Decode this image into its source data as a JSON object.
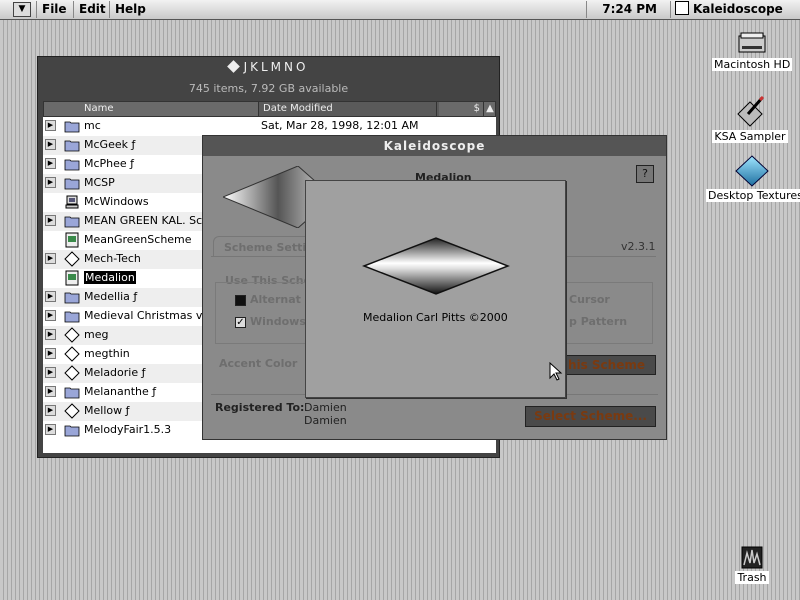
{
  "menubar": {
    "items": [
      "File",
      "Edit",
      "Help"
    ],
    "clock": "7:24 PM",
    "app_name": "Kaleidoscope"
  },
  "desktop": {
    "icons": [
      {
        "label": "Macintosh HD",
        "icon": "hard-disk-icon"
      },
      {
        "label": "KSA Sampler",
        "icon": "paintbrush-icon"
      },
      {
        "label": "Desktop Textures",
        "icon": "diamond-icon"
      },
      {
        "label": "Trash",
        "icon": "trash-icon"
      }
    ]
  },
  "finder": {
    "title": "JKLMNO",
    "info": "745 items, 7.92 GB available",
    "columns": {
      "name": "Name",
      "date": "Date Modified",
      "sort": "$"
    },
    "rows": [
      {
        "name": "mc",
        "date": "Sat, Mar 28, 1998, 12:01 AM",
        "icon": "folder-icon",
        "has_triangle": true
      },
      {
        "name": "McGeek ƒ",
        "date": "",
        "icon": "folder-icon",
        "has_triangle": true
      },
      {
        "name": "McPhee ƒ",
        "date": "",
        "icon": "folder-icon",
        "has_triangle": true
      },
      {
        "name": "MCSP",
        "date": "",
        "icon": "folder-icon",
        "has_triangle": true
      },
      {
        "name": "McWindows",
        "date": "",
        "icon": "computer-icon",
        "has_triangle": false
      },
      {
        "name": "MEAN GREEN KAL. Scher",
        "date": "",
        "icon": "folder-icon",
        "has_triangle": true
      },
      {
        "name": "MeanGreenScheme",
        "date": "",
        "icon": "scheme-file-icon",
        "has_triangle": false
      },
      {
        "name": "Mech-Tech",
        "date": "",
        "icon": "diamond-folder-icon",
        "has_triangle": true
      },
      {
        "name": "Medalion",
        "date": "",
        "icon": "scheme-file-icon",
        "has_triangle": false,
        "selected": true
      },
      {
        "name": "Medellia ƒ",
        "date": "",
        "icon": "folder-icon",
        "has_triangle": true
      },
      {
        "name": "Medieval Christmas v2.",
        "date": "",
        "icon": "folder-icon",
        "has_triangle": true
      },
      {
        "name": "meg",
        "date": "",
        "icon": "diamond-folder-icon",
        "has_triangle": true
      },
      {
        "name": "megthin",
        "date": "",
        "icon": "diamond-folder-icon",
        "has_triangle": true
      },
      {
        "name": "Meladorie ƒ",
        "date": "",
        "icon": "diamond-folder-icon",
        "has_triangle": true
      },
      {
        "name": "Melananthe ƒ",
        "date": "",
        "icon": "folder-icon",
        "has_triangle": true
      },
      {
        "name": "Mellow ƒ",
        "date": "",
        "icon": "diamond-folder-icon",
        "has_triangle": true
      },
      {
        "name": "MelodyFair1.5.3",
        "date": "",
        "icon": "folder-icon",
        "has_triangle": true
      }
    ]
  },
  "kaleidoscope": {
    "title": "Kaleidoscope",
    "scheme_name": "Medalion",
    "version": "v2.3.1",
    "tab_label": "Scheme Setti",
    "use_this_label": "Use This Sche",
    "alternate_label": "Alternat",
    "window_label": "Windows",
    "cursor_label": "Cursor",
    "pattern_label": "p Pattern",
    "accent_label": "Accent Color",
    "use_scheme_button": "his Scheme",
    "registered_label": "Registered To:",
    "registered_name_1": "Damien",
    "registered_name_2": "Damien",
    "select_button": "Select Scheme..."
  },
  "about": {
    "scheme_name": "Medalion",
    "credit": "Carl Pitts ©2000"
  }
}
